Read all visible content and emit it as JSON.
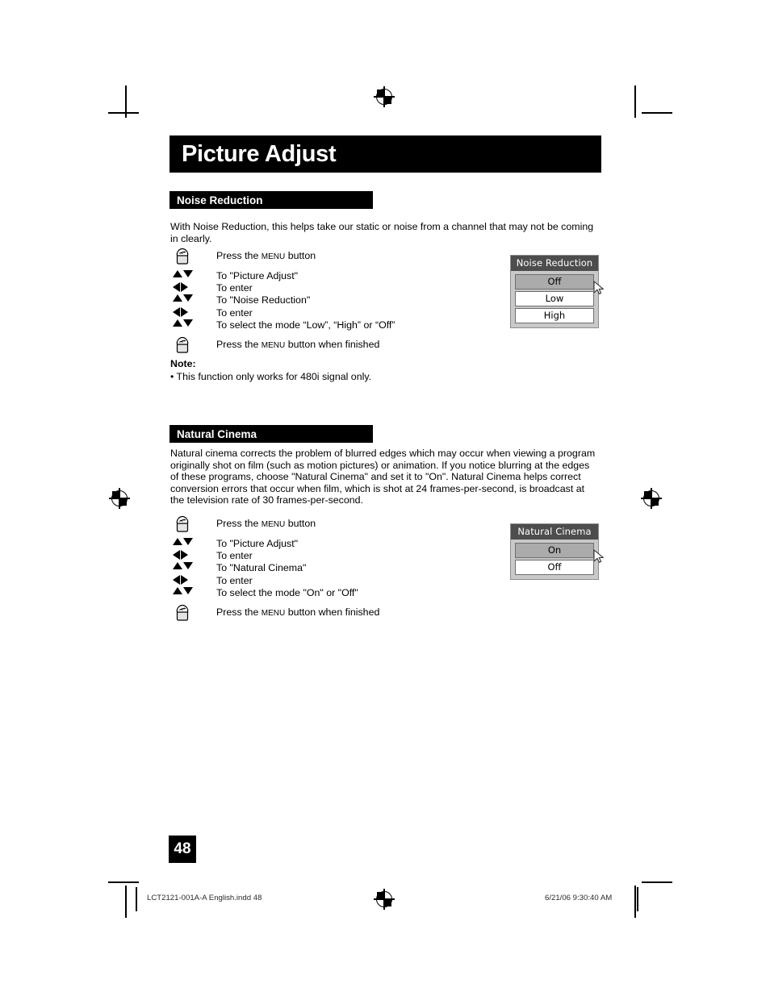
{
  "page": {
    "title": "Picture Adjust",
    "number": "48"
  },
  "sections": [
    {
      "heading": "Noise Reduction",
      "body": "With Noise Reduction, this helps take our static or noise from a channel that may not be coming in clearly.",
      "steps": [
        {
          "icon": "hand-press-icon",
          "label_pre": "Press the ",
          "label_sc": "Menu",
          "label_post": " button"
        },
        {
          "icon": "up-down-arrows-icon",
          "label": "To \"Picture Adjust\""
        },
        {
          "icon": "left-right-arrows-icon",
          "label": "To enter"
        },
        {
          "icon": "up-down-arrows-icon",
          "label": "To \"Noise Reduction\""
        },
        {
          "icon": "left-right-arrows-icon",
          "label": "To enter"
        },
        {
          "icon": "up-down-arrows-icon",
          "label": "To select the mode “Low”, “High” or “Off”"
        },
        {
          "icon": "hand-press-icon",
          "label_pre": "Press the ",
          "label_sc": "Menu",
          "label_post": " button when finished"
        }
      ],
      "note": {
        "heading": "Note:",
        "items": [
          "•  This function only works for 480i signal only."
        ]
      },
      "osd": {
        "title": "Noise Reduction",
        "options": [
          {
            "label": "Off",
            "selected": true
          },
          {
            "label": "Low",
            "selected": false
          },
          {
            "label": "High",
            "selected": false
          }
        ]
      }
    },
    {
      "heading": "Natural Cinema",
      "body": "Natural cinema corrects the problem of blurred edges which may occur when viewing a program originally shot on film (such as motion pictures) or animation. If you notice blurring at the edges of these programs, choose \"Natural Cinema\" and set it to \"On\". Natural Cinema helps correct conversion errors that occur when film, which is shot at 24 frames-per-second, is broadcast at the television rate of 30 frames-per-second.",
      "steps": [
        {
          "icon": "hand-press-icon",
          "label_pre": "Press the ",
          "label_sc": "Menu",
          "label_post": " button"
        },
        {
          "icon": "up-down-arrows-icon",
          "label": "To \"Picture Adjust\""
        },
        {
          "icon": "left-right-arrows-icon",
          "label": "To enter"
        },
        {
          "icon": "up-down-arrows-icon",
          "label": "To \"Natural Cinema\""
        },
        {
          "icon": "left-right-arrows-icon",
          "label": "To enter"
        },
        {
          "icon": "up-down-arrows-icon",
          "label": "To select the mode \"On\" or \"Off\""
        },
        {
          "icon": "hand-press-icon",
          "label_pre": "Press the ",
          "label_sc": "Menu",
          "label_post": " button when finished"
        }
      ],
      "osd": {
        "title": "Natural Cinema",
        "options": [
          {
            "label": "On",
            "selected": true
          },
          {
            "label": "Off",
            "selected": false
          }
        ]
      }
    }
  ],
  "footer": {
    "left": "LCT2121-001A-A English.indd   48",
    "right": "6/21/06   9:30:40 AM"
  },
  "colors": {
    "bar_black": "#000000",
    "osd_header": "#4d4d4d",
    "osd_body": "#c9c9c9",
    "osd_selected": "#ababab"
  }
}
